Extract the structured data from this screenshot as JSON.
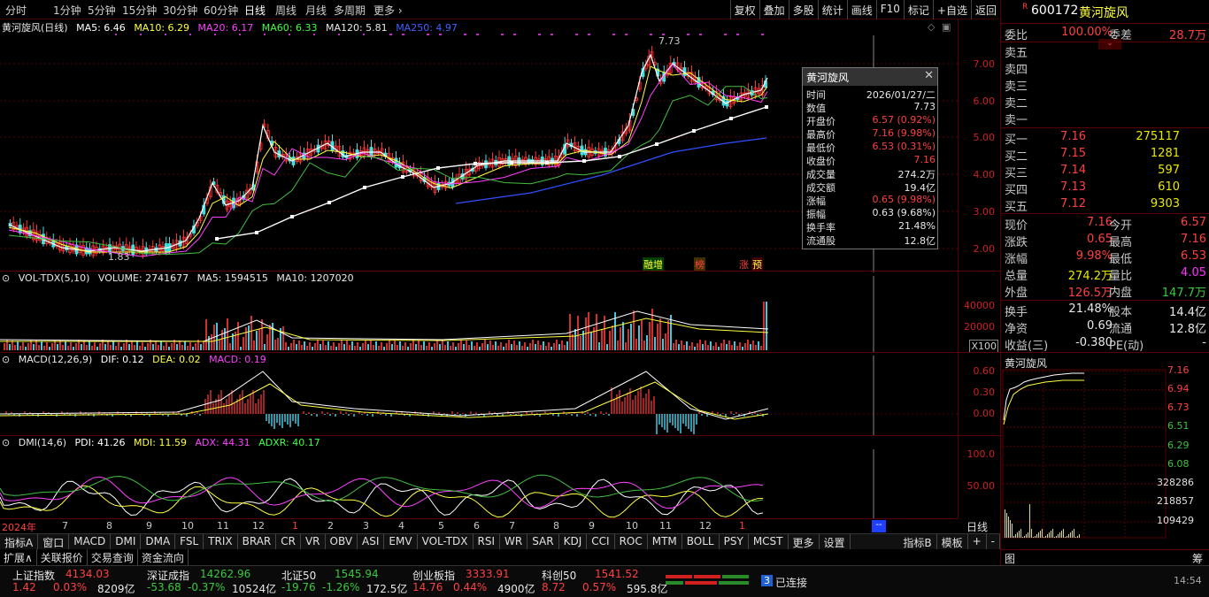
{
  "topbar": {
    "periods": [
      "分时",
      "1分钟",
      "5分钟",
      "15分钟",
      "30分钟",
      "60分钟",
      "日线",
      "周线",
      "月线",
      "多周期",
      "更多"
    ],
    "active_period": "日线",
    "tools": [
      "复权",
      "叠加",
      "多股",
      "统计",
      "画线",
      "F10",
      "标记",
      "+自选",
      "返回"
    ]
  },
  "kline": {
    "title": "黄河旋风(日线)",
    "ma": [
      {
        "label": "MA5: 6.46",
        "color": "#ffffff"
      },
      {
        "label": "MA10: 6.29",
        "color": "#ffff40"
      },
      {
        "label": "MA20: 6.17",
        "color": "#ff40ff"
      },
      {
        "label": "MA60: 6.33",
        "color": "#40ff40"
      },
      {
        "label": "MA120: 5.81",
        "color": "#e8e8e8"
      },
      {
        "label": "MA250: 4.97",
        "color": "#4060ff"
      }
    ],
    "y_ticks": [
      "7.00",
      "6.00",
      "5.00",
      "4.00",
      "3.00",
      "2.00"
    ],
    "high_mark": "7.73",
    "low_mark": "1.83",
    "tags": [
      "融增",
      "榜",
      "涨",
      "预"
    ]
  },
  "popup": {
    "title": "黄河旋风",
    "rows": [
      {
        "k": "时间",
        "v": "2026/01/27/二",
        "c": "white"
      },
      {
        "k": "数值",
        "v": "7.73",
        "c": "white"
      },
      {
        "k": "开盘价",
        "v": "6.57 (0.92%)",
        "c": "red"
      },
      {
        "k": "最高价",
        "v": "7.16 (9.98%)",
        "c": "red"
      },
      {
        "k": "最低价",
        "v": "6.53 (0.31%)",
        "c": "red"
      },
      {
        "k": "收盘价",
        "v": "7.16",
        "c": "red"
      },
      {
        "k": "成交量",
        "v": "274.2万",
        "c": "white"
      },
      {
        "k": "成交额",
        "v": "19.4亿",
        "c": "white"
      },
      {
        "k": "涨幅",
        "v": "0.65 (9.98%)",
        "c": "red"
      },
      {
        "k": "振幅",
        "v": "0.63 (9.68%)",
        "c": "white"
      },
      {
        "k": "换手率",
        "v": "21.48%",
        "c": "white"
      },
      {
        "k": "流通股",
        "v": "12.8亿",
        "c": "white"
      }
    ]
  },
  "vol": {
    "title": "VOL-TDX(5,10)",
    "values": [
      "VOLUME: 2741677",
      "MA5: 1594515",
      "MA10: 1207020"
    ],
    "y_ticks": [
      "40000",
      "20000"
    ],
    "unit": "X100"
  },
  "macd": {
    "title": "MACD(12,26,9)",
    "values": [
      {
        "label": "DIF: 0.12",
        "color": "#ffffff"
      },
      {
        "label": "DEA: 0.02",
        "color": "#ffff40"
      },
      {
        "label": "MACD: 0.19",
        "color": "#ff40ff"
      }
    ],
    "y_ticks": [
      "0.60",
      "0.30",
      "0.00"
    ]
  },
  "dmi": {
    "title": "DMI(14,6)",
    "values": [
      {
        "label": "PDI: 41.26",
        "color": "#ffffff"
      },
      {
        "label": "MDI: 11.59",
        "color": "#ffff40"
      },
      {
        "label": "ADX: 44.31",
        "color": "#ff40ff"
      },
      {
        "label": "ADXR: 40.17",
        "color": "#40ff40"
      }
    ],
    "y_ticks": [
      "100.0",
      "50.00"
    ]
  },
  "xaxis": [
    "2024年",
    "7",
    "8",
    "9",
    "10",
    "11",
    "12",
    "1",
    "2",
    "3",
    "4",
    "5",
    "6",
    "7",
    "8",
    "9",
    "10",
    "11",
    "12",
    "1"
  ],
  "xaxis_right": "日线",
  "tabs1": [
    "指标A",
    "窗口",
    "MACD",
    "DMI",
    "DMA",
    "FSL",
    "TRIX",
    "BRAR",
    "CR",
    "VR",
    "OBV",
    "ASI",
    "EMV",
    "VOL-TDX",
    "RSI",
    "WR",
    "SAR",
    "KDJ",
    "CCI",
    "ROC",
    "MTM",
    "BOLL",
    "PSY",
    "MCST",
    "更多",
    "设置"
  ],
  "tabs1_right": [
    "指标B",
    "模板",
    "+",
    "-"
  ],
  "tabs2": [
    "扩展∧",
    "关联报价",
    "交易查询",
    "资金流向"
  ],
  "side": {
    "code": "600172",
    "name": "黄河旋风",
    "weibi_label": "委比",
    "weibi": "100.00%",
    "weicha_label": "委差",
    "weicha": "28.7万",
    "sells": [
      "卖五",
      "卖四",
      "卖三",
      "卖二",
      "卖一"
    ],
    "buys": [
      {
        "k": "买一",
        "p": "7.16",
        "v": "275117"
      },
      {
        "k": "买二",
        "p": "7.15",
        "v": "1281"
      },
      {
        "k": "买三",
        "p": "7.14",
        "v": "597"
      },
      {
        "k": "买四",
        "p": "7.13",
        "v": "610"
      },
      {
        "k": "买五",
        "p": "7.12",
        "v": "9303"
      }
    ],
    "quote": [
      {
        "k1": "现价",
        "v1": "7.16",
        "c1": "red",
        "k2": "今开",
        "v2": "6.57",
        "c2": "red"
      },
      {
        "k1": "涨跌",
        "v1": "0.65",
        "c1": "red",
        "k2": "最高",
        "v2": "7.16",
        "c2": "red"
      },
      {
        "k1": "涨幅",
        "v1": "9.98%",
        "c1": "red",
        "k2": "最低",
        "v2": "6.53",
        "c2": "red"
      },
      {
        "k1": "总量",
        "v1": "274.2万",
        "c1": "yellow",
        "k2": "量比",
        "v2": "4.05",
        "c2": "magenta"
      },
      {
        "k1": "外盘",
        "v1": "126.5万",
        "c1": "red",
        "k2": "内盘",
        "v2": "147.7万",
        "c2": "green"
      }
    ],
    "stats": [
      {
        "k1": "换手",
        "v1": "21.48%",
        "k2": "股本",
        "v2": "14.4亿"
      },
      {
        "k1": "净资",
        "v1": "0.69",
        "k2": "流通",
        "v2": "12.8亿"
      },
      {
        "k1": "收益(三)",
        "v1": "-0.380",
        "k2": "PE(动)",
        "v2": "-"
      }
    ],
    "mini_title": "黄河旋风",
    "mini_prices": [
      "7.16",
      "6.94",
      "6.73",
      "6.51",
      "6.29",
      "6.08"
    ],
    "mini_vols": [
      "328286",
      "218857",
      "109429"
    ]
  },
  "indexbar": [
    {
      "name": "上证指数",
      "val": "4134.03",
      "chg": "1.42",
      "pct": "0.03%",
      "amt": "8209亿",
      "up": true
    },
    {
      "name": "深证成指",
      "val": "14262.96",
      "chg": "-53.68",
      "pct": "-0.37%",
      "amt": "10524亿",
      "up": false
    },
    {
      "name": "北证50",
      "val": "1545.94",
      "chg": "-19.76",
      "pct": "-1.26%",
      "amt": "172.5亿",
      "up": false
    },
    {
      "name": "创业板指",
      "val": "3333.91",
      "chg": "14.76",
      "pct": "0.44%",
      "amt": "4900亿",
      "up": true
    },
    {
      "name": "科创50",
      "val": "1541.52",
      "chg": "8.72",
      "pct": "0.57%",
      "amt": "595.8亿",
      "up": true
    }
  ],
  "connection": {
    "count": "3",
    "label": "已连接"
  },
  "clock": "14:54"
}
